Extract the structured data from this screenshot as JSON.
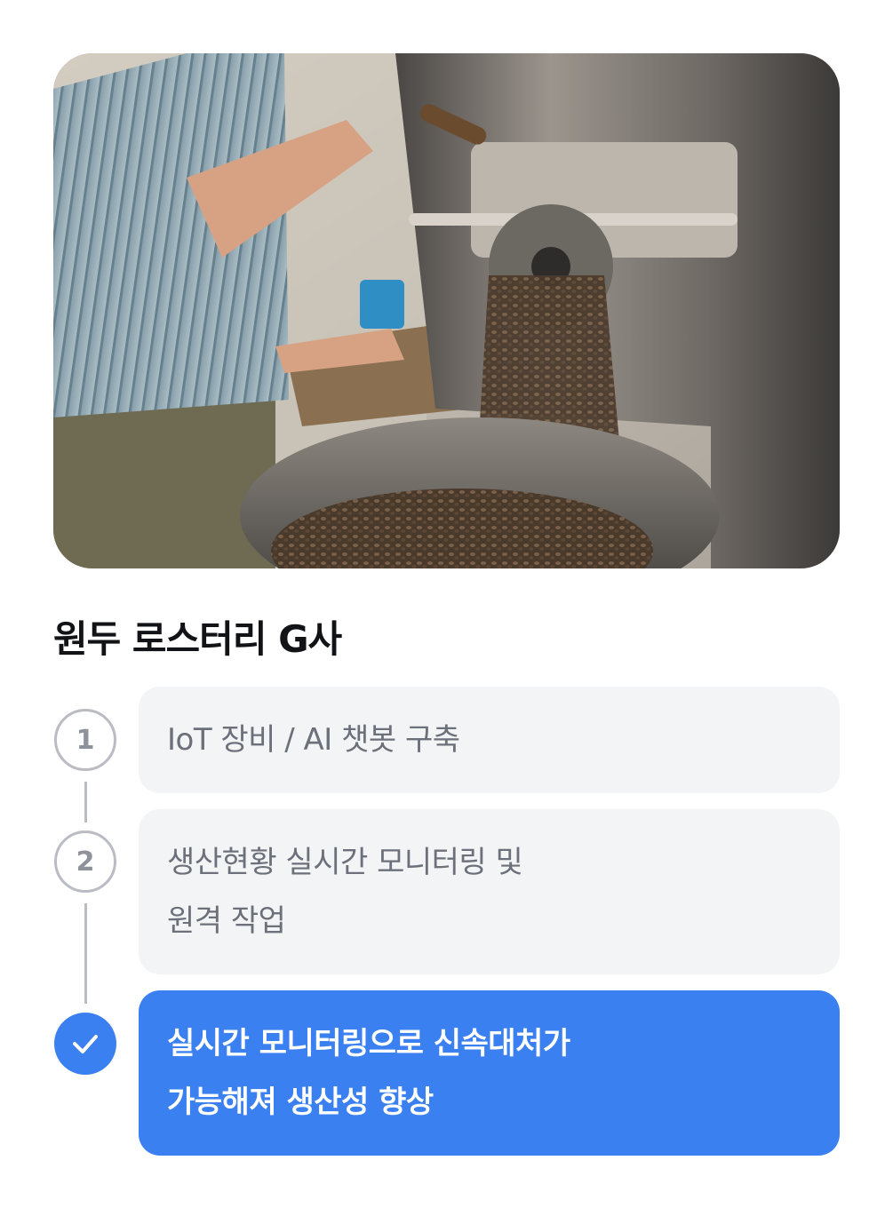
{
  "hero": {
    "icon": "roaster-photo"
  },
  "title": "원두 로스터리 G사",
  "steps": [
    {
      "marker": "1",
      "lines": [
        "IoT 장비 / AI 챗봇 구축"
      ]
    },
    {
      "marker": "2",
      "lines": [
        "생산현황 실시간 모니터링 및",
        "원격 작업"
      ]
    },
    {
      "marker_icon": "check-icon",
      "lines": [
        "실시간 모니터링으로 신속대처가",
        "가능해져 생산성 향상"
      ]
    }
  ],
  "colors": {
    "accent": "#3a80f0",
    "card_bg": "#f3f4f6",
    "muted_text": "#6c707a",
    "title": "#111317"
  }
}
